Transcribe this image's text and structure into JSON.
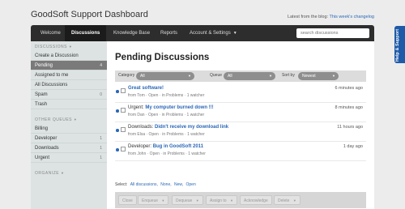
{
  "app": {
    "title": "GoodSoft Support Dashboard",
    "blog_prefix": "Latest from the blog:",
    "blog_link": "This week's changelog"
  },
  "nav": {
    "tabs": [
      {
        "label": "Welcome"
      },
      {
        "label": "Discussions"
      },
      {
        "label": "Knowledge Base"
      },
      {
        "label": "Reports"
      },
      {
        "label": "Account & Settings"
      }
    ],
    "search_placeholder": "search discussions"
  },
  "help_tab": {
    "label": "Help & Support"
  },
  "sidebar": {
    "sections": [
      {
        "heading": "DISCUSSIONS"
      },
      {
        "heading": "OTHER QUEUES"
      },
      {
        "heading": "ORGANIZE"
      }
    ],
    "discussions": [
      {
        "label": "Create a Discussion",
        "count": ""
      },
      {
        "label": "Pending",
        "count": "4"
      },
      {
        "label": "Assigned to me",
        "count": ""
      },
      {
        "label": "All Discussions",
        "count": ""
      },
      {
        "label": "Spam",
        "count": "0"
      },
      {
        "label": "Trash",
        "count": ""
      }
    ],
    "queues": [
      {
        "label": "Billing",
        "count": ""
      },
      {
        "label": "Developer",
        "count": "1"
      },
      {
        "label": "Downloads",
        "count": "1"
      },
      {
        "label": "Urgent",
        "count": "1"
      }
    ]
  },
  "main": {
    "title": "Pending Discussions",
    "filters": {
      "category_label": "Category",
      "category_value": "All",
      "queue_label": "Queue",
      "queue_value": "All",
      "sort_label": "Sort by",
      "sort_value": "Newest"
    },
    "rows": [
      {
        "prefix": "",
        "subject": "Great software!",
        "meta": "from Tom · Open · in Problems · 1 watcher",
        "time": "6 minutes ago"
      },
      {
        "prefix": "Urgent: ",
        "subject": "My computer burned down !!!",
        "meta": "from Dan · Open · in Problems · 1 watcher",
        "time": "8 minutes ago"
      },
      {
        "prefix": "Downloads: ",
        "subject": "Didn't receive my download link",
        "meta": "from Elsa · Open · in Problems · 1 watcher",
        "time": "11 hours ago"
      },
      {
        "prefix": "Developer: ",
        "subject": "Bug in GoodSoft 2011",
        "meta": "from John · Open · in Problems · 1 watcher",
        "time": "1 day ago"
      }
    ],
    "select": {
      "label": "Select:",
      "options": [
        "All discussions,",
        "None,",
        "New,",
        "Open"
      ]
    },
    "actions": [
      {
        "label": "Close"
      },
      {
        "label": "Enqueue"
      },
      {
        "label": "Dequeue"
      },
      {
        "label": "Assign to"
      },
      {
        "label": "Acknowledge"
      },
      {
        "label": "Delete"
      }
    ]
  }
}
